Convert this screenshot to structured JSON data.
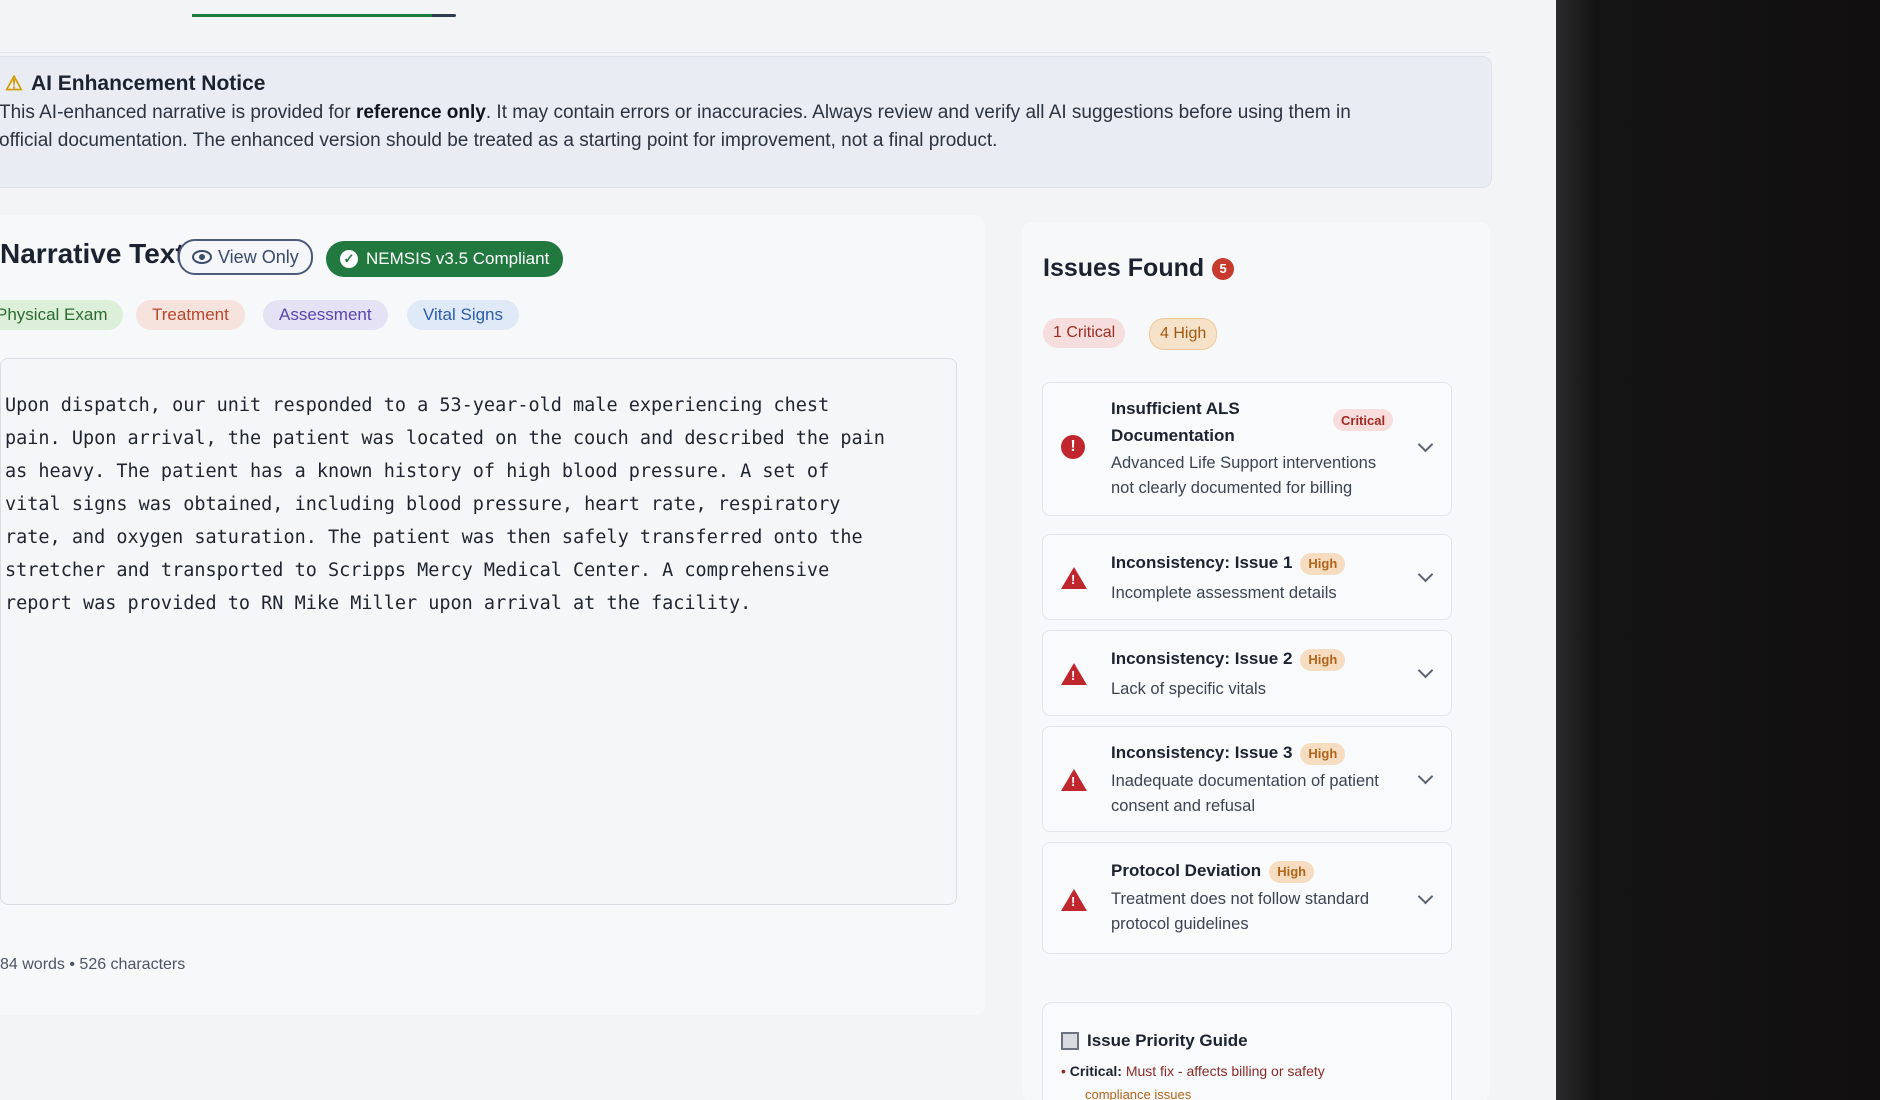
{
  "notice": {
    "title": "AI Enhancement Notice",
    "body_prefix": "This AI-enhanced narrative is provided for ",
    "body_bold": "reference only",
    "body_suffix": ". It may contain errors or inaccuracies. Always review and verify all AI suggestions before using them in official documentation. The enhanced version should be treated as a starting point for improvement, not a final product."
  },
  "narrative": {
    "title": "Narrative Text",
    "view_only_label": "View Only",
    "compliance_label": "NEMSIS v3.5 Compliant",
    "section_chips": [
      "Physical Exam",
      "Treatment",
      "Assessment",
      "Vital Signs"
    ],
    "text": "Upon dispatch, our unit responded to a 53-year-old male experiencing chest\npain. Upon arrival, the patient was located on the couch and described the pain\nas heavy. The patient has a known history of high blood pressure. A set of\nvital signs was obtained, including blood pressure, heart rate, respiratory\nrate, and oxygen saturation. The patient was then safely transferred onto the\nstretcher and transported to Scripps Mercy Medical Center. A comprehensive\nreport was provided to RN Mike Miller upon arrival at the facility.",
    "word_count_label": "84 words • 526 characters"
  },
  "issues": {
    "title": "Issues Found",
    "count": "5",
    "summary": {
      "critical": "1 Critical",
      "high": "4 High"
    },
    "items": [
      {
        "title": "Insufficient ALS Documentation",
        "severity": "Critical",
        "description": "Advanced Life Support interventions not clearly documented for billing"
      },
      {
        "title": "Inconsistency: Issue 1",
        "severity": "High",
        "description": "Incomplete assessment details"
      },
      {
        "title": "Inconsistency: Issue 2",
        "severity": "High",
        "description": "Lack of specific vitals"
      },
      {
        "title": "Inconsistency: Issue 3",
        "severity": "High",
        "description": "Inadequate documentation of patient consent and refusal"
      },
      {
        "title": "Protocol Deviation",
        "severity": "High",
        "description": "Treatment does not follow standard protocol guidelines"
      }
    ]
  },
  "guide": {
    "title": "Issue Priority Guide",
    "critical_label": "Critical:",
    "critical_text": "Must fix - affects billing or safety",
    "high_text": "compliance issues"
  },
  "colors": {
    "compliant_green": "#22793f",
    "critical_red": "#c0262d",
    "high_orange": "#b0651a"
  }
}
